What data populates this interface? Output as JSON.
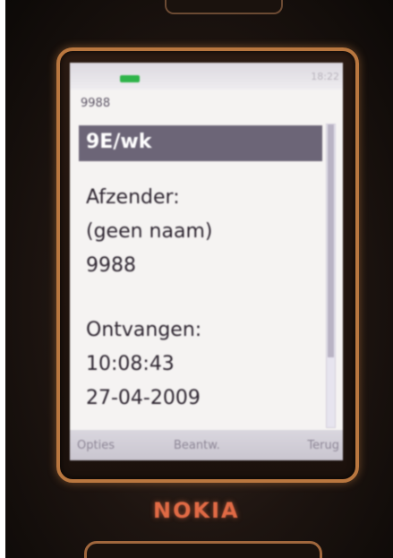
{
  "screen": {
    "status": {
      "clock": "18:22"
    },
    "sender_code": "9988",
    "header": "9E/wk",
    "body": {
      "sender_label": "Afzender:",
      "sender_name": "(geen naam)",
      "sender_number": "9988",
      "received_label": "Ontvangen:",
      "received_time": "10:08:43",
      "received_date": "27-04-2009"
    },
    "softkeys": {
      "left": "Opties",
      "middle": "Beantw.",
      "right": "Terug"
    }
  },
  "device": {
    "brand": "NOKIA"
  },
  "colors": {
    "signal": "#2fb44a",
    "header_band": "#6c6577",
    "brand": "#e06a45",
    "bezel_rim": "#b9773f"
  },
  "icons": [
    "signal-bar-icon",
    "scrollbar"
  ]
}
